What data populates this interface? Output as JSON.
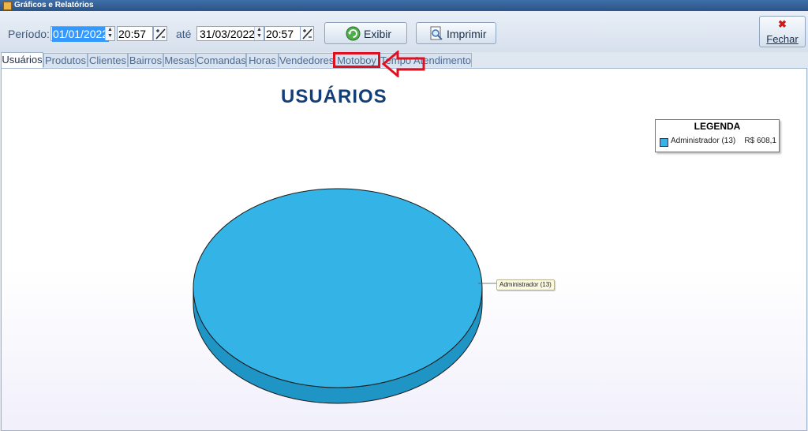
{
  "window": {
    "title": "Gráficos e Relatórios"
  },
  "toolbar": {
    "periodo_label": "Período:",
    "date_start": "01/01/2022",
    "time_start": "20:57",
    "ate_label": "até",
    "date_end": "31/03/2022",
    "time_end": "20:57",
    "exibir_label": "Exibir",
    "imprimir_label": "Imprimir",
    "fechar_label": "Fechar"
  },
  "tabs": [
    {
      "label": "Usuários",
      "active": true
    },
    {
      "label": "Produtos"
    },
    {
      "label": "Clientes"
    },
    {
      "label": "Bairros"
    },
    {
      "label": "Mesas"
    },
    {
      "label": "Comandas"
    },
    {
      "label": "Horas"
    },
    {
      "label": "Vendedores"
    },
    {
      "label": "Motoboy",
      "highlighted": true
    },
    {
      "label": "Tempo Atendimento"
    }
  ],
  "chart_data": {
    "type": "pie",
    "title": "USUÁRIOS",
    "legend_title": "LEGENDA",
    "legend_position": "top-right",
    "slices": [
      {
        "label": "Administrador (13)",
        "value_text": "R$ 608,1",
        "value": 608.1,
        "fraction": 1.0,
        "color": "#34b4e6"
      }
    ]
  },
  "colors": {
    "accent": "#123f78",
    "pie": "#34b4e6",
    "highlight": "#e01020"
  }
}
